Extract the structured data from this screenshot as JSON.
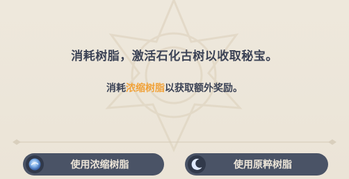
{
  "dialog": {
    "message_main": "消耗树脂，激活石化古树以收取秘宝。",
    "message_sub_prefix": "消耗",
    "message_sub_highlight": "浓缩树脂",
    "message_sub_suffix": "以获取额外奖励。",
    "highlight_color": "#f0a23a"
  },
  "buttons": {
    "condensed_resin_label": "使用浓缩树脂",
    "condensed_resin_icon": "condensed-resin-icon",
    "original_resin_label": "使用原粹树脂",
    "original_resin_icon": "crescent-moon-icon"
  }
}
